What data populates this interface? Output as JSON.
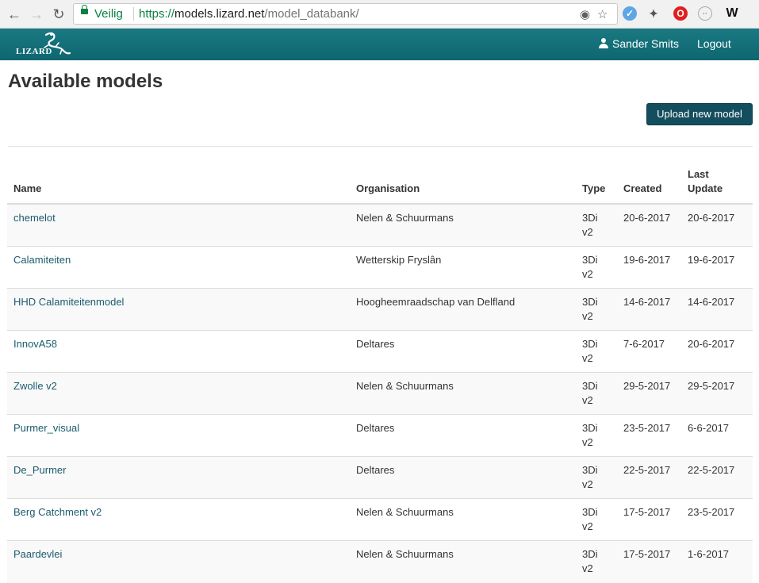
{
  "browser": {
    "secure_label": "Veilig",
    "url_scheme": "https://",
    "url_host": "models.lizard.net",
    "url_path": "/model_databank/"
  },
  "nav": {
    "logo_text": "LIZARD",
    "user_name": "Sander Smits",
    "logout_label": "Logout",
    "bar_color": "#137079"
  },
  "page": {
    "title": "Available models",
    "upload_button": "Upload new model"
  },
  "table": {
    "headers": {
      "name": "Name",
      "organisation": "Organisation",
      "type": "Type",
      "created": "Created",
      "last_update_line1": "Last",
      "last_update_line2": "Update"
    },
    "rows": [
      {
        "name": "chemelot",
        "organisation": "Nelen & Schuurmans",
        "type1": "3Di",
        "type2": "v2",
        "created": "20-6-2017",
        "updated": "20-6-2017"
      },
      {
        "name": "Calamiteiten",
        "organisation": "Wetterskip Fryslân",
        "type1": "3Di",
        "type2": "v2",
        "created": "19-6-2017",
        "updated": "19-6-2017"
      },
      {
        "name": "HHD Calamiteitenmodel",
        "organisation": "Hoogheemraadschap van Delfland",
        "type1": "3Di",
        "type2": "v2",
        "created": "14-6-2017",
        "updated": "14-6-2017"
      },
      {
        "name": "InnovA58",
        "organisation": "Deltares",
        "type1": "3Di",
        "type2": "v2",
        "created": "7-6-2017",
        "updated": "20-6-2017"
      },
      {
        "name": "Zwolle v2",
        "organisation": "Nelen & Schuurmans",
        "type1": "3Di",
        "type2": "v2",
        "created": "29-5-2017",
        "updated": "29-5-2017"
      },
      {
        "name": "Purmer_visual",
        "organisation": "Deltares",
        "type1": "3Di",
        "type2": "v2",
        "created": "23-5-2017",
        "updated": "6-6-2017"
      },
      {
        "name": "De_Purmer",
        "organisation": "Deltares",
        "type1": "3Di",
        "type2": "v2",
        "created": "22-5-2017",
        "updated": "22-5-2017"
      },
      {
        "name": "Berg Catchment v2",
        "organisation": "Nelen & Schuurmans",
        "type1": "3Di",
        "type2": "v2",
        "created": "17-5-2017",
        "updated": "23-5-2017"
      },
      {
        "name": "Paardevlei",
        "organisation": "Nelen & Schuurmans",
        "type1": "3Di",
        "type2": "v2",
        "created": "17-5-2017",
        "updated": "1-6-2017"
      }
    ]
  }
}
